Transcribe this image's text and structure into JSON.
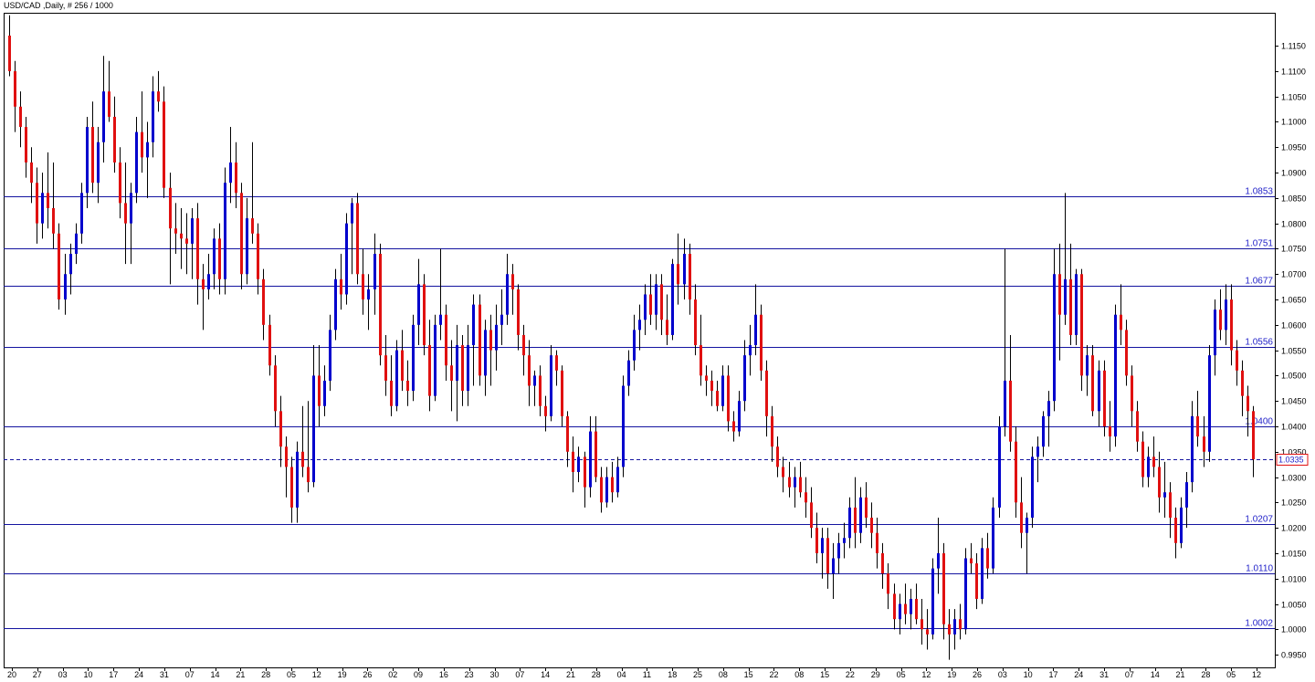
{
  "chart_data": {
    "type": "candlestick",
    "title": "USD/CAD ,Daily, # 256 / 1000",
    "ylim": [
      0.9925,
      1.1215
    ],
    "y_ticks": [
      "1.1150",
      "1.1100",
      "1.1050",
      "1.1000",
      "1.0950",
      "1.0900",
      "1.0850",
      "1.0800",
      "1.0750",
      "1.0700",
      "1.0650",
      "1.0600",
      "1.0550",
      "1.0500",
      "1.0450",
      "1.0400",
      "1.0350",
      "1.0300",
      "1.0250",
      "1.0200",
      "1.0150",
      "1.0100",
      "1.0050",
      "1.0000",
      "0.9950"
    ],
    "x_labels": [
      "20",
      "27",
      "03",
      "10",
      "17",
      "24",
      "31",
      "07",
      "14",
      "21",
      "28",
      "05",
      "12",
      "19",
      "26",
      "02",
      "09",
      "16",
      "23",
      "30",
      "07",
      "14",
      "21",
      "28",
      "04",
      "11",
      "18",
      "25",
      "08",
      "15",
      "22",
      "08",
      "15",
      "22",
      "29",
      "05",
      "12",
      "19",
      "26",
      "03",
      "10",
      "17",
      "24",
      "31",
      "07",
      "14",
      "21",
      "28",
      "05",
      "12"
    ],
    "levels": [
      {
        "label": "1.0853",
        "value": 1.0853
      },
      {
        "label": "1.0751",
        "value": 1.0751
      },
      {
        "label": "1.0677",
        "value": 1.0677
      },
      {
        "label": "1.0556",
        "value": 1.0556
      },
      {
        "label": "1.0400",
        "value": 1.04
      },
      {
        "label": "1.0207",
        "value": 1.0207
      },
      {
        "label": "1.0110",
        "value": 1.011
      },
      {
        "label": "1.0002",
        "value": 1.0002
      }
    ],
    "current_price": {
      "label": "1.0335",
      "value": 1.0335
    },
    "colors": {
      "up": "#0000cc",
      "down": "#e01010",
      "wick": "#000000",
      "level": "#1414a0",
      "border": "#000000"
    },
    "candles": [
      [
        1.117,
        1.121,
        1.109,
        1.11
      ],
      [
        1.11,
        1.112,
        1.098,
        1.103
      ],
      [
        1.103,
        1.106,
        1.095,
        1.099
      ],
      [
        1.099,
        1.101,
        1.089,
        1.092
      ],
      [
        1.092,
        1.095,
        1.084,
        1.088
      ],
      [
        1.088,
        1.091,
        1.076,
        1.08
      ],
      [
        1.08,
        1.09,
        1.077,
        1.086
      ],
      [
        1.086,
        1.094,
        1.079,
        1.083
      ],
      [
        1.083,
        1.092,
        1.075,
        1.078
      ],
      [
        1.078,
        1.08,
        1.063,
        1.065
      ],
      [
        1.065,
        1.074,
        1.062,
        1.07
      ],
      [
        1.07,
        1.076,
        1.066,
        1.074
      ],
      [
        1.074,
        1.08,
        1.072,
        1.078
      ],
      [
        1.078,
        1.088,
        1.076,
        1.086
      ],
      [
        1.086,
        1.101,
        1.083,
        1.099
      ],
      [
        1.099,
        1.104,
        1.086,
        1.088
      ],
      [
        1.088,
        1.099,
        1.084,
        1.096
      ],
      [
        1.096,
        1.113,
        1.092,
        1.106
      ],
      [
        1.106,
        1.112,
        1.1,
        1.101
      ],
      [
        1.101,
        1.105,
        1.09,
        1.092
      ],
      [
        1.092,
        1.095,
        1.081,
        1.084
      ],
      [
        1.084,
        1.092,
        1.072,
        1.08
      ],
      [
        1.08,
        1.088,
        1.072,
        1.086
      ],
      [
        1.086,
        1.101,
        1.084,
        1.098
      ],
      [
        1.098,
        1.106,
        1.09,
        1.093
      ],
      [
        1.093,
        1.1,
        1.085,
        1.096
      ],
      [
        1.096,
        1.109,
        1.093,
        1.106
      ],
      [
        1.106,
        1.11,
        1.102,
        1.104
      ],
      [
        1.104,
        1.107,
        1.085,
        1.087
      ],
      [
        1.087,
        1.09,
        1.068,
        1.079
      ],
      [
        1.079,
        1.084,
        1.074,
        1.078
      ],
      [
        1.078,
        1.083,
        1.071,
        1.077
      ],
      [
        1.077,
        1.082,
        1.07,
        1.076
      ],
      [
        1.076,
        1.083,
        1.069,
        1.081
      ],
      [
        1.081,
        1.084,
        1.064,
        1.069
      ],
      [
        1.069,
        1.072,
        1.059,
        1.067
      ],
      [
        1.067,
        1.074,
        1.065,
        1.07
      ],
      [
        1.07,
        1.079,
        1.067,
        1.077
      ],
      [
        1.077,
        1.08,
        1.066,
        1.069
      ],
      [
        1.069,
        1.091,
        1.066,
        1.088
      ],
      [
        1.088,
        1.099,
        1.084,
        1.092
      ],
      [
        1.092,
        1.096,
        1.083,
        1.086
      ],
      [
        1.086,
        1.088,
        1.067,
        1.07
      ],
      [
        1.07,
        1.085,
        1.068,
        1.081
      ],
      [
        1.081,
        1.096,
        1.076,
        1.078
      ],
      [
        1.078,
        1.08,
        1.066,
        1.069
      ],
      [
        1.069,
        1.071,
        1.057,
        1.06
      ],
      [
        1.06,
        1.062,
        1.05,
        1.052
      ],
      [
        1.052,
        1.054,
        1.04,
        1.043
      ],
      [
        1.043,
        1.046,
        1.032,
        1.036
      ],
      [
        1.036,
        1.038,
        1.026,
        1.032
      ],
      [
        1.032,
        1.034,
        1.021,
        1.024
      ],
      [
        1.024,
        1.037,
        1.021,
        1.035
      ],
      [
        1.035,
        1.044,
        1.03,
        1.032
      ],
      [
        1.032,
        1.045,
        1.027,
        1.029
      ],
      [
        1.029,
        1.056,
        1.028,
        1.05
      ],
      [
        1.05,
        1.056,
        1.04,
        1.044
      ],
      [
        1.044,
        1.052,
        1.042,
        1.049
      ],
      [
        1.049,
        1.062,
        1.047,
        1.059
      ],
      [
        1.059,
        1.071,
        1.057,
        1.069
      ],
      [
        1.069,
        1.074,
        1.063,
        1.066
      ],
      [
        1.066,
        1.082,
        1.064,
        1.08
      ],
      [
        1.08,
        1.085,
        1.07,
        1.084
      ],
      [
        1.084,
        1.086,
        1.068,
        1.07
      ],
      [
        1.07,
        1.075,
        1.062,
        1.065
      ],
      [
        1.065,
        1.07,
        1.059,
        1.067
      ],
      [
        1.067,
        1.078,
        1.062,
        1.074
      ],
      [
        1.074,
        1.076,
        1.052,
        1.054
      ],
      [
        1.054,
        1.058,
        1.046,
        1.049
      ],
      [
        1.049,
        1.054,
        1.042,
        1.044
      ],
      [
        1.044,
        1.057,
        1.043,
        1.055
      ],
      [
        1.055,
        1.059,
        1.047,
        1.049
      ],
      [
        1.049,
        1.053,
        1.044,
        1.047
      ],
      [
        1.047,
        1.062,
        1.045,
        1.06
      ],
      [
        1.06,
        1.073,
        1.056,
        1.068
      ],
      [
        1.068,
        1.07,
        1.054,
        1.056
      ],
      [
        1.056,
        1.061,
        1.043,
        1.046
      ],
      [
        1.046,
        1.062,
        1.045,
        1.06
      ],
      [
        1.06,
        1.075,
        1.057,
        1.062
      ],
      [
        1.062,
        1.064,
        1.049,
        1.052
      ],
      [
        1.052,
        1.057,
        1.043,
        1.049
      ],
      [
        1.049,
        1.06,
        1.041,
        1.056
      ],
      [
        1.056,
        1.058,
        1.044,
        1.047
      ],
      [
        1.047,
        1.06,
        1.044,
        1.056
      ],
      [
        1.056,
        1.066,
        1.048,
        1.064
      ],
      [
        1.064,
        1.066,
        1.048,
        1.05
      ],
      [
        1.05,
        1.061,
        1.046,
        1.059
      ],
      [
        1.059,
        1.062,
        1.048,
        1.055
      ],
      [
        1.055,
        1.064,
        1.051,
        1.06
      ],
      [
        1.06,
        1.067,
        1.056,
        1.062
      ],
      [
        1.062,
        1.074,
        1.06,
        1.07
      ],
      [
        1.07,
        1.072,
        1.062,
        1.067
      ],
      [
        1.067,
        1.068,
        1.055,
        1.058
      ],
      [
        1.058,
        1.06,
        1.05,
        1.054
      ],
      [
        1.054,
        1.057,
        1.044,
        1.048
      ],
      [
        1.048,
        1.051,
        1.044,
        1.05
      ],
      [
        1.05,
        1.052,
        1.042,
        1.044
      ],
      [
        1.044,
        1.046,
        1.039,
        1.042
      ],
      [
        1.042,
        1.056,
        1.041,
        1.054
      ],
      [
        1.054,
        1.055,
        1.048,
        1.051
      ],
      [
        1.051,
        1.052,
        1.04,
        1.042
      ],
      [
        1.042,
        1.043,
        1.032,
        1.035
      ],
      [
        1.035,
        1.038,
        1.027,
        1.031
      ],
      [
        1.031,
        1.036,
        1.029,
        1.034
      ],
      [
        1.034,
        1.035,
        1.024,
        1.028
      ],
      [
        1.028,
        1.042,
        1.026,
        1.039
      ],
      [
        1.039,
        1.042,
        1.029,
        1.03
      ],
      [
        1.03,
        1.032,
        1.023,
        1.025
      ],
      [
        1.025,
        1.032,
        1.024,
        1.03
      ],
      [
        1.03,
        1.033,
        1.025,
        1.027
      ],
      [
        1.027,
        1.034,
        1.026,
        1.032
      ],
      [
        1.032,
        1.05,
        1.03,
        1.048
      ],
      [
        1.048,
        1.055,
        1.046,
        1.053
      ],
      [
        1.053,
        1.062,
        1.051,
        1.059
      ],
      [
        1.059,
        1.064,
        1.055,
        1.061
      ],
      [
        1.061,
        1.068,
        1.058,
        1.066
      ],
      [
        1.066,
        1.07,
        1.06,
        1.062
      ],
      [
        1.062,
        1.07,
        1.059,
        1.068
      ],
      [
        1.068,
        1.07,
        1.058,
        1.061
      ],
      [
        1.061,
        1.066,
        1.056,
        1.058
      ],
      [
        1.058,
        1.073,
        1.057,
        1.072
      ],
      [
        1.072,
        1.078,
        1.064,
        1.068
      ],
      [
        1.068,
        1.077,
        1.065,
        1.074
      ],
      [
        1.074,
        1.076,
        1.062,
        1.065
      ],
      [
        1.065,
        1.068,
        1.054,
        1.056
      ],
      [
        1.056,
        1.062,
        1.048,
        1.05
      ],
      [
        1.05,
        1.052,
        1.046,
        1.049
      ],
      [
        1.049,
        1.051,
        1.044,
        1.047
      ],
      [
        1.047,
        1.049,
        1.043,
        1.044
      ],
      [
        1.044,
        1.052,
        1.043,
        1.05
      ],
      [
        1.05,
        1.052,
        1.039,
        1.041
      ],
      [
        1.041,
        1.043,
        1.037,
        1.039
      ],
      [
        1.039,
        1.047,
        1.038,
        1.045
      ],
      [
        1.045,
        1.057,
        1.043,
        1.054
      ],
      [
        1.054,
        1.06,
        1.05,
        1.056
      ],
      [
        1.056,
        1.068,
        1.054,
        1.062
      ],
      [
        1.062,
        1.064,
        1.049,
        1.051
      ],
      [
        1.051,
        1.053,
        1.038,
        1.042
      ],
      [
        1.042,
        1.044,
        1.033,
        1.036
      ],
      [
        1.036,
        1.038,
        1.03,
        1.032
      ],
      [
        1.032,
        1.034,
        1.027,
        1.03
      ],
      [
        1.03,
        1.033,
        1.026,
        1.028
      ],
      [
        1.028,
        1.032,
        1.024,
        1.03
      ],
      [
        1.03,
        1.033,
        1.026,
        1.027
      ],
      [
        1.027,
        1.03,
        1.022,
        1.025
      ],
      [
        1.025,
        1.028,
        1.018,
        1.02
      ],
      [
        1.02,
        1.023,
        1.013,
        1.015
      ],
      [
        1.015,
        1.02,
        1.01,
        1.018
      ],
      [
        1.018,
        1.02,
        1.008,
        1.011
      ],
      [
        1.011,
        1.017,
        1.006,
        1.014
      ],
      [
        1.014,
        1.019,
        1.011,
        1.017
      ],
      [
        1.017,
        1.021,
        1.014,
        1.018
      ],
      [
        1.018,
        1.026,
        1.016,
        1.024
      ],
      [
        1.024,
        1.03,
        1.016,
        1.019
      ],
      [
        1.019,
        1.028,
        1.017,
        1.026
      ],
      [
        1.026,
        1.029,
        1.02,
        1.022
      ],
      [
        1.022,
        1.025,
        1.016,
        1.019
      ],
      [
        1.019,
        1.022,
        1.012,
        1.015
      ],
      [
        1.015,
        1.017,
        1.008,
        1.011
      ],
      [
        1.011,
        1.013,
        1.004,
        1.007
      ],
      [
        1.007,
        1.009,
        1.0,
        1.002
      ],
      [
        1.002,
        1.007,
        0.999,
        1.005
      ],
      [
        1.005,
        1.009,
        1.001,
        1.003
      ],
      [
        1.003,
        1.008,
        1.0,
        1.006
      ],
      [
        1.006,
        1.009,
        1.001,
        1.002
      ],
      [
        1.002,
        1.006,
        0.997,
        1.0
      ],
      [
        1.0,
        1.004,
        0.996,
        0.999
      ],
      [
        0.999,
        1.014,
        0.998,
        1.012
      ],
      [
        1.012,
        1.022,
        1.007,
        1.015
      ],
      [
        1.015,
        1.017,
        0.998,
        1.001
      ],
      [
        1.001,
        1.004,
        0.994,
        0.999
      ],
      [
        0.999,
        1.004,
        0.996,
        1.002
      ],
      [
        1.002,
        1.005,
        0.998,
        1.0
      ],
      [
        1.0,
        1.016,
        0.999,
        1.014
      ],
      [
        1.014,
        1.017,
        1.011,
        1.013
      ],
      [
        1.013,
        1.015,
        1.004,
        1.006
      ],
      [
        1.006,
        1.018,
        1.005,
        1.016
      ],
      [
        1.016,
        1.019,
        1.01,
        1.012
      ],
      [
        1.012,
        1.026,
        1.011,
        1.024
      ],
      [
        1.024,
        1.042,
        1.022,
        1.04
      ],
      [
        1.04,
        1.075,
        1.038,
        1.049
      ],
      [
        1.049,
        1.058,
        1.035,
        1.037
      ],
      [
        1.037,
        1.04,
        1.022,
        1.025
      ],
      [
        1.025,
        1.03,
        1.016,
        1.019
      ],
      [
        1.019,
        1.023,
        1.011,
        1.022
      ],
      [
        1.022,
        1.036,
        1.02,
        1.034
      ],
      [
        1.034,
        1.038,
        1.029,
        1.036
      ],
      [
        1.036,
        1.043,
        1.034,
        1.042
      ],
      [
        1.042,
        1.047,
        1.036,
        1.045
      ],
      [
        1.045,
        1.075,
        1.043,
        1.07
      ],
      [
        1.07,
        1.076,
        1.053,
        1.062
      ],
      [
        1.062,
        1.086,
        1.06,
        1.069
      ],
      [
        1.069,
        1.076,
        1.056,
        1.058
      ],
      [
        1.058,
        1.071,
        1.056,
        1.07
      ],
      [
        1.07,
        1.071,
        1.047,
        1.05
      ],
      [
        1.05,
        1.056,
        1.046,
        1.054
      ],
      [
        1.054,
        1.056,
        1.042,
        1.043
      ],
      [
        1.043,
        1.053,
        1.04,
        1.051
      ],
      [
        1.051,
        1.053,
        1.038,
        1.04
      ],
      [
        1.04,
        1.045,
        1.035,
        1.038
      ],
      [
        1.038,
        1.064,
        1.036,
        1.062
      ],
      [
        1.062,
        1.068,
        1.056,
        1.059
      ],
      [
        1.059,
        1.061,
        1.048,
        1.05
      ],
      [
        1.05,
        1.052,
        1.04,
        1.043
      ],
      [
        1.043,
        1.045,
        1.035,
        1.037
      ],
      [
        1.037,
        1.039,
        1.028,
        1.03
      ],
      [
        1.03,
        1.036,
        1.028,
        1.034
      ],
      [
        1.034,
        1.038,
        1.03,
        1.032
      ],
      [
        1.032,
        1.035,
        1.023,
        1.026
      ],
      [
        1.026,
        1.033,
        1.022,
        1.027
      ],
      [
        1.027,
        1.029,
        1.018,
        1.022
      ],
      [
        1.022,
        1.024,
        1.014,
        1.017
      ],
      [
        1.017,
        1.026,
        1.016,
        1.024
      ],
      [
        1.024,
        1.031,
        1.02,
        1.029
      ],
      [
        1.029,
        1.045,
        1.027,
        1.042
      ],
      [
        1.042,
        1.047,
        1.036,
        1.038
      ],
      [
        1.038,
        1.042,
        1.032,
        1.035
      ],
      [
        1.035,
        1.056,
        1.033,
        1.054
      ],
      [
        1.054,
        1.065,
        1.05,
        1.063
      ],
      [
        1.063,
        1.067,
        1.057,
        1.059
      ],
      [
        1.059,
        1.068,
        1.056,
        1.065
      ],
      [
        1.065,
        1.068,
        1.052,
        1.055
      ],
      [
        1.055,
        1.057,
        1.048,
        1.051
      ],
      [
        1.051,
        1.053,
        1.042,
        1.046
      ],
      [
        1.046,
        1.048,
        1.038,
        1.043
      ],
      [
        1.043,
        1.044,
        1.03,
        1.0335
      ]
    ]
  }
}
